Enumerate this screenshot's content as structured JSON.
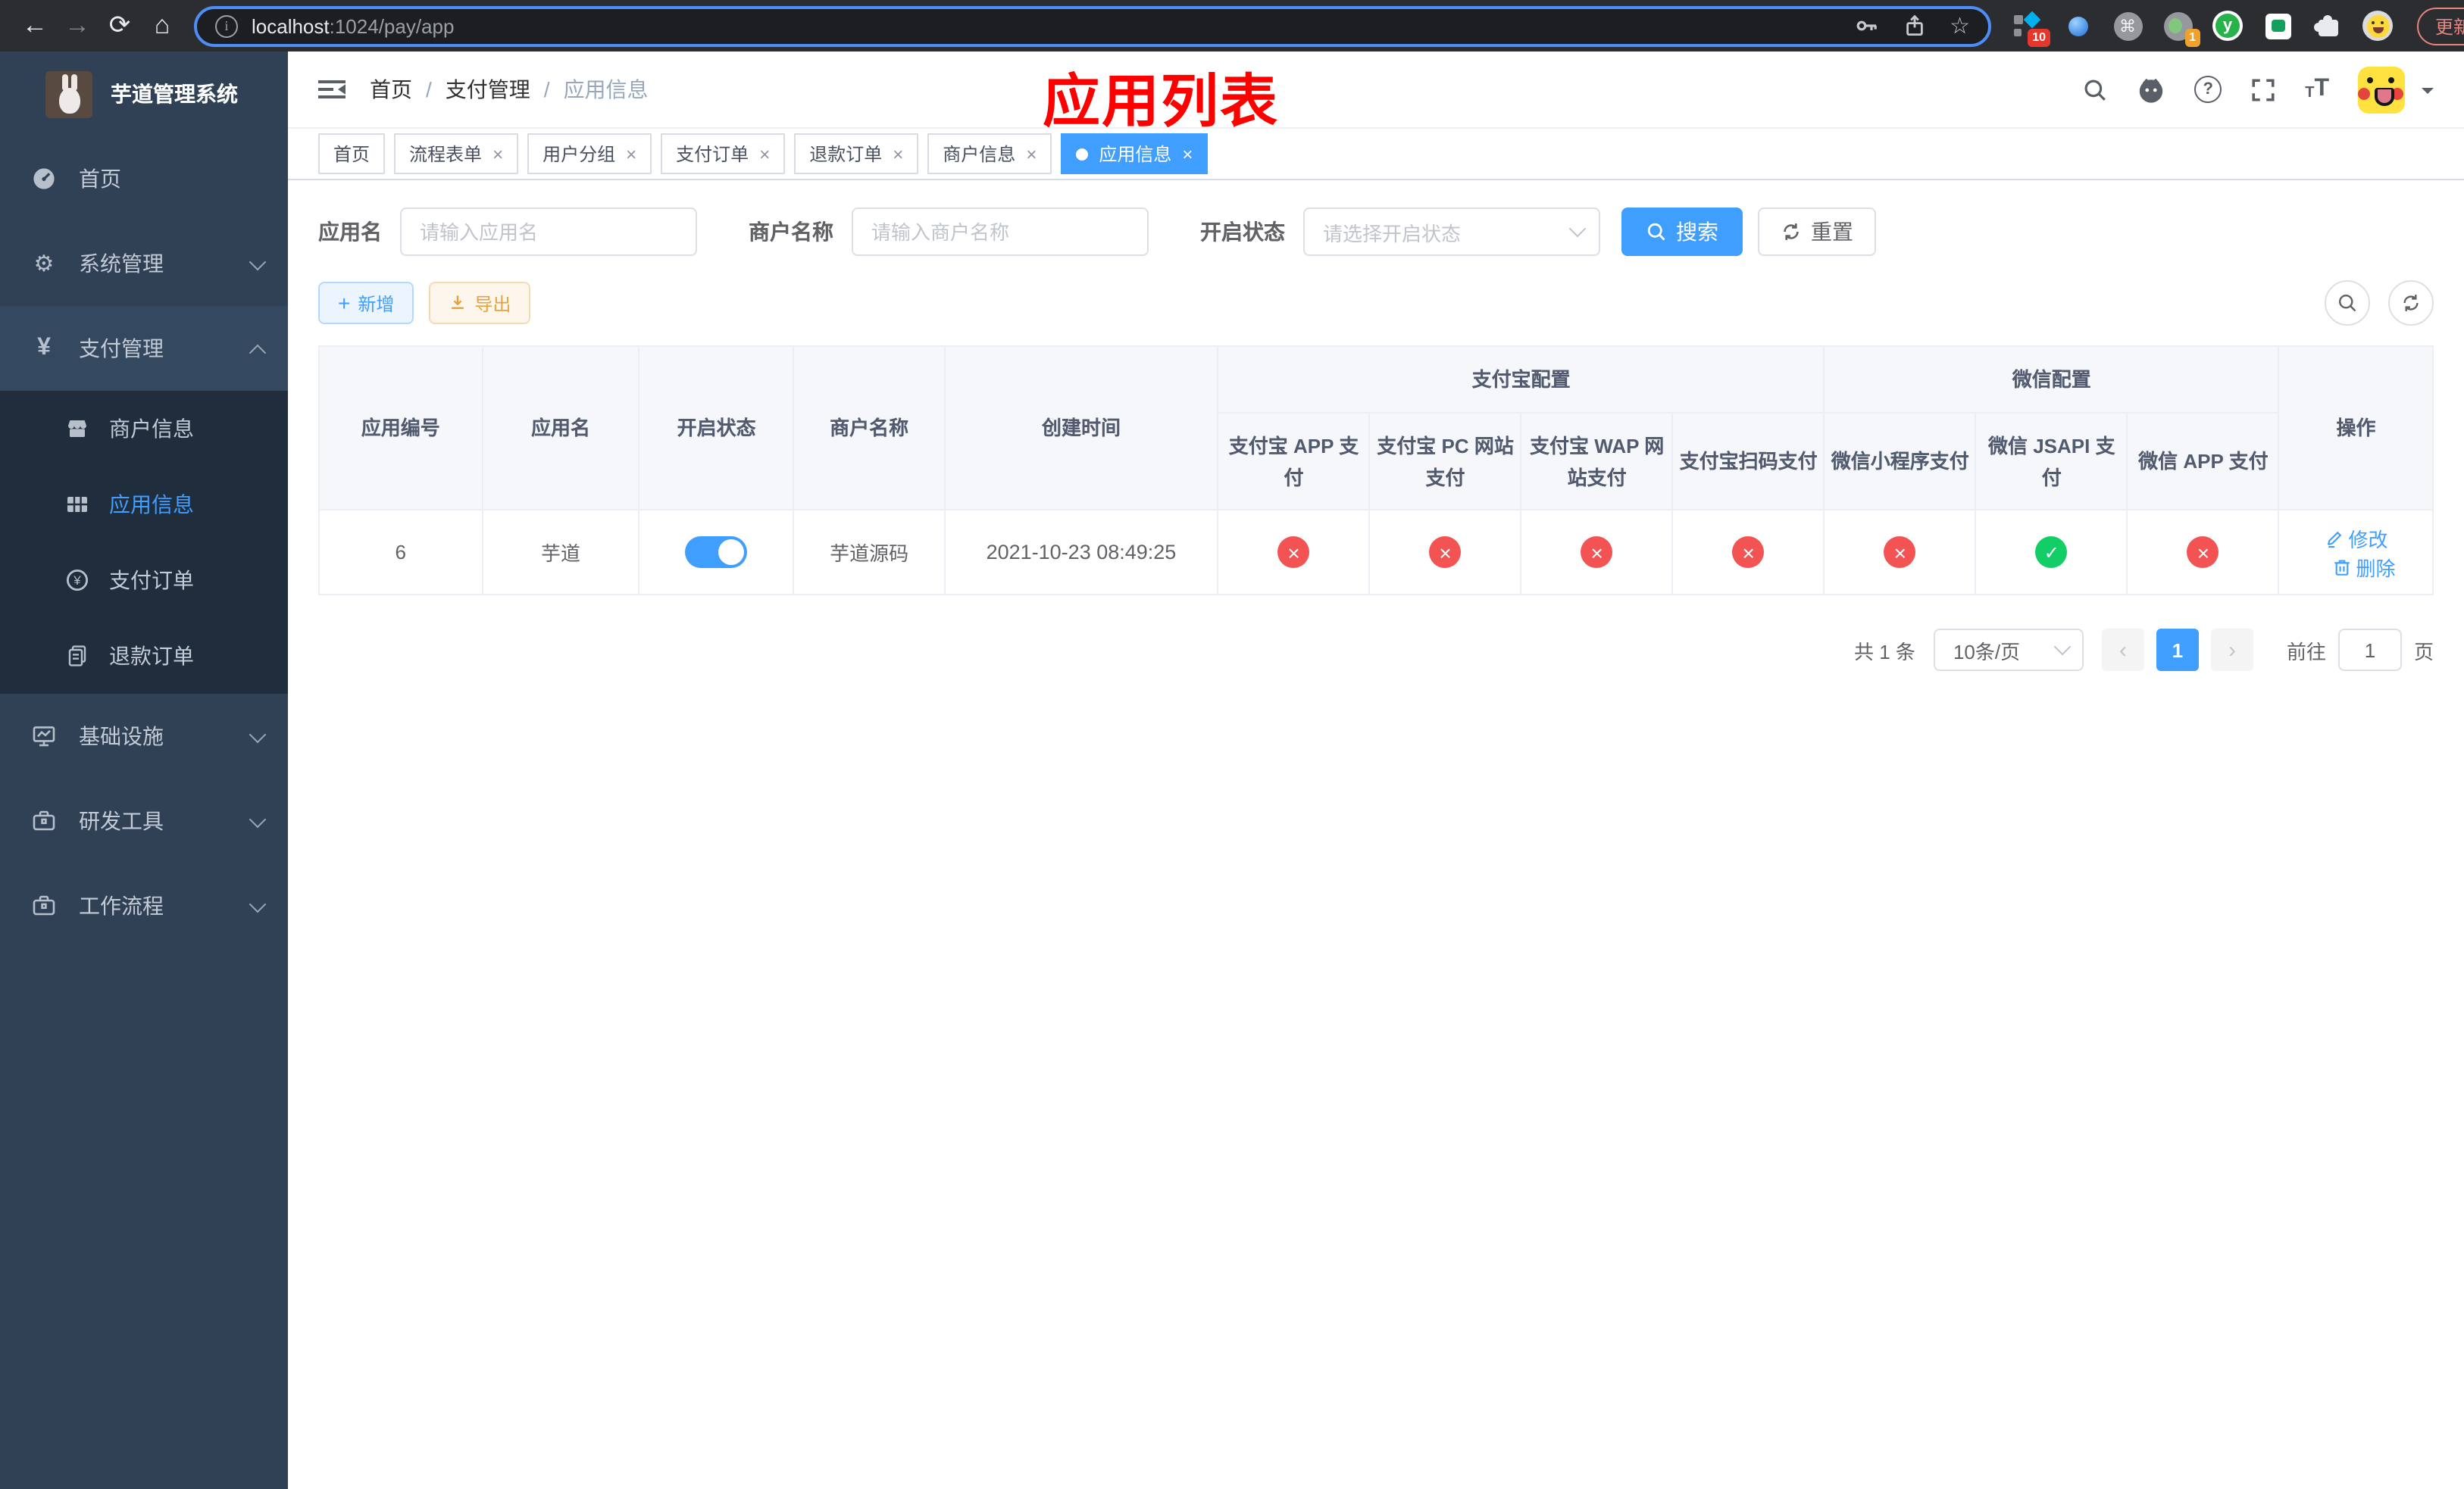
{
  "browser": {
    "url_host": "localhost",
    "url_path": ":1024/pay/app",
    "update_label": "更新",
    "ext_badge_blocks": "10",
    "ext_badge_rec": "1",
    "ext_y_letter": "y"
  },
  "icons": {
    "back": "←",
    "forward": "→",
    "reload": "⟳",
    "home": "⌂",
    "info": "i",
    "star": "☆",
    "cmd": "⌘",
    "kebab": "⋮",
    "gear": "⚙",
    "yen": "¥",
    "help": "?",
    "close": "×",
    "prev": "‹",
    "next": "›",
    "sep": "/",
    "plus": "+",
    "t_small": "T",
    "t_big": "T"
  },
  "sidebar": {
    "title": "芋道管理系统",
    "menu": [
      {
        "label": "首页"
      },
      {
        "label": "系统管理"
      },
      {
        "label": "支付管理",
        "expanded": true,
        "children": [
          {
            "label": "商户信息"
          },
          {
            "label": "应用信息",
            "active": true
          },
          {
            "label": "支付订单"
          },
          {
            "label": "退款订单"
          }
        ]
      },
      {
        "label": "基础设施"
      },
      {
        "label": "研发工具"
      },
      {
        "label": "工作流程"
      }
    ]
  },
  "header": {
    "breadcrumb": [
      "首页",
      "支付管理",
      "应用信息"
    ],
    "annotation": "应用列表"
  },
  "tabs": [
    {
      "label": "首页"
    },
    {
      "label": "流程表单"
    },
    {
      "label": "用户分组"
    },
    {
      "label": "支付订单"
    },
    {
      "label": "退款订单"
    },
    {
      "label": "商户信息"
    },
    {
      "label": "应用信息",
      "active": true
    }
  ],
  "filters": {
    "app_name_label": "应用名",
    "app_name_placeholder": "请输入应用名",
    "merchant_label": "商户名称",
    "merchant_placeholder": "请输入商户名称",
    "status_label": "开启状态",
    "status_placeholder": "请选择开启状态",
    "search_label": "搜索",
    "reset_label": "重置"
  },
  "toolbar": {
    "add_label": "新增",
    "export_label": "导出"
  },
  "table": {
    "columns": [
      "应用编号",
      "应用名",
      "开启状态",
      "商户名称",
      "创建时间"
    ],
    "groups": [
      {
        "label": "支付宝配置",
        "children": [
          "支付宝 APP 支付",
          "支付宝 PC 网站支付",
          "支付宝 WAP 网站支付",
          "支付宝扫码支付"
        ]
      },
      {
        "label": "微信配置",
        "children": [
          "微信小程序支付",
          "微信 JSAPI 支付",
          "微信 APP 支付"
        ]
      }
    ],
    "action_column": "操作",
    "rows": [
      {
        "id": "6",
        "name": "芋道",
        "status": "on",
        "merchant": "芋道源码",
        "created": "2021-10-23 08:49:25",
        "channels": [
          "fail",
          "fail",
          "fail",
          "fail",
          "fail",
          "ok",
          "fail"
        ],
        "edit_label": "修改",
        "delete_label": "删除"
      }
    ]
  },
  "pagination": {
    "total": "共 1 条",
    "page_size": "10条/页",
    "page": "1",
    "goto_label": "前往",
    "goto_value": "1",
    "goto_suffix": "页"
  },
  "colors": {
    "accent": "#409eff",
    "success": "#13ce66",
    "danger": "#f35352",
    "warning": "#e6a23c",
    "sidebar_bg": "#304156",
    "submenu_bg": "#1f2d3d"
  }
}
